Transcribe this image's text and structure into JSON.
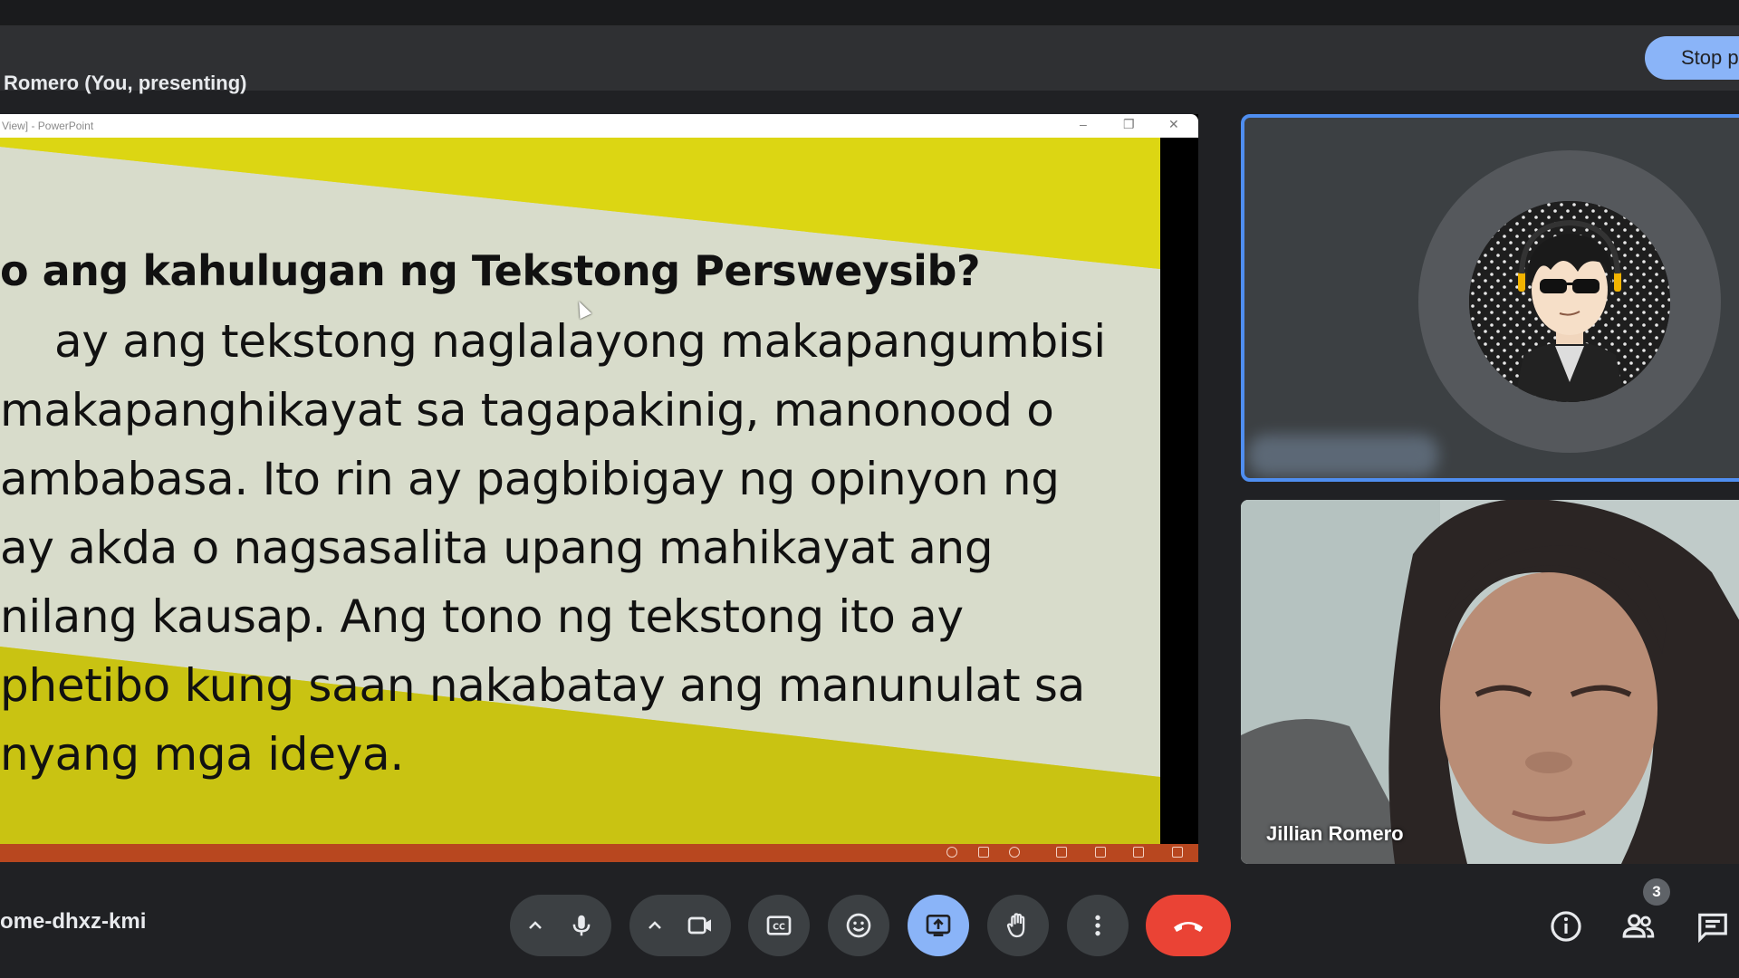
{
  "banner": {
    "presenter_text": "Romero (You, presenting)",
    "stop_button_label": "Stop p"
  },
  "presentation": {
    "window_title": "View] - PowerPoint",
    "slide_title": "o ang kahulugan ng Tekstong Persweysib?",
    "slide_lines": [
      "ay ang tekstong naglalayong makapangumbisi",
      "makapanghikayat sa tagapakinig, manonood o",
      "ambabasa. Ito rin ay pagbibigay ng opinyon ng",
      "ay akda o nagsasalita upang mahikayat ang",
      "nilang kausap. Ang tono ng tekstong ito ay",
      "phetibo kung saan nakabatay ang manunulat sa",
      "nyang mga ideya."
    ]
  },
  "participants": {
    "tile2_name": "Jillian Romero"
  },
  "footer": {
    "meeting_code": "ome-dhxz-kmi",
    "people_count": "3"
  },
  "colors": {
    "accent": "#8ab4f8",
    "hangup": "#ea4335",
    "slide_yellow": "#dcd613",
    "slide_gray": "#d8dccb"
  }
}
